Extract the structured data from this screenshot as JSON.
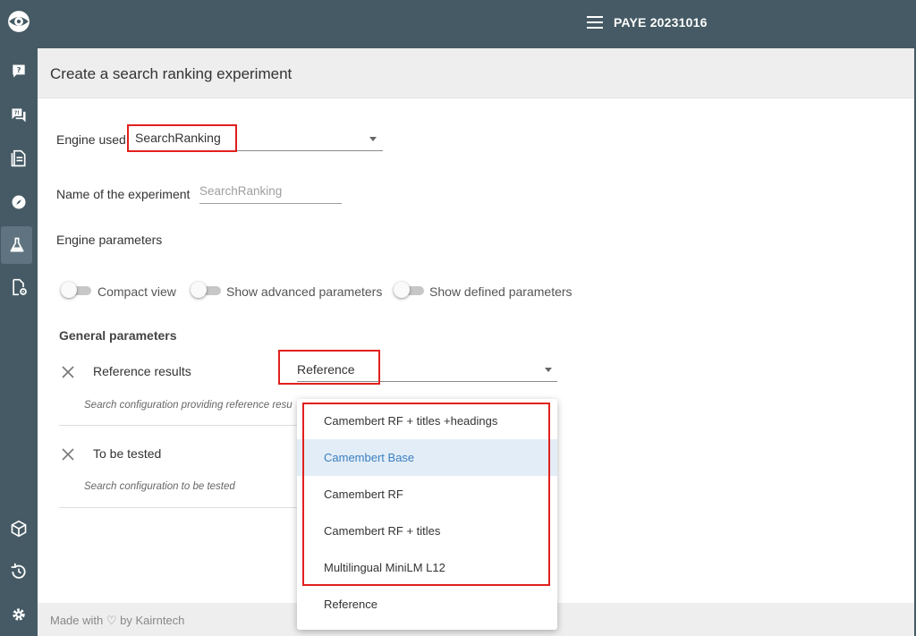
{
  "header": {
    "app_title": "PAYE 20231016",
    "menu_icon": "hamburger-menu-icon"
  },
  "sidebar": {
    "icons": [
      "logo-eye-icon",
      "question-chat-icon",
      "qa-forum-icon",
      "document-icon",
      "compass-icon",
      "flask-icon",
      "file-settings-icon",
      "cube-icon",
      "history-icon",
      "settings-gear-icon"
    ],
    "active": "flask-icon"
  },
  "page": {
    "title": "Create a search ranking experiment"
  },
  "form": {
    "engine_label": "Engine used",
    "engine_value": "SearchRanking",
    "name_label": "Name of the experiment",
    "name_placeholder": "SearchRanking",
    "engine_params_label": "Engine parameters",
    "toggles": [
      {
        "label": "Compact view",
        "on": false
      },
      {
        "label": "Show advanced parameters",
        "on": false
      },
      {
        "label": "Show defined parameters",
        "on": false
      }
    ],
    "general_title": "General parameters",
    "reference": {
      "label": "Reference results",
      "value": "Reference",
      "hint": "Search configuration providing reference resu"
    },
    "tested": {
      "label": "To be tested",
      "hint": "Search configuration to be tested"
    }
  },
  "dropdown": {
    "options": [
      "Camembert RF + titles +headings",
      "Camembert Base",
      "Camembert RF",
      "Camembert RF + titles",
      "Multilingual MiniLM L12",
      "Reference"
    ],
    "highlighted": "Camembert Base"
  },
  "footer": {
    "text": "Made with ♡ by Kairntech"
  },
  "colors": {
    "sidebar": "#455a64",
    "highlight_text": "#3a7fc0",
    "highlight_bg": "#e3edf7",
    "annotation_red": "#e0201e"
  }
}
